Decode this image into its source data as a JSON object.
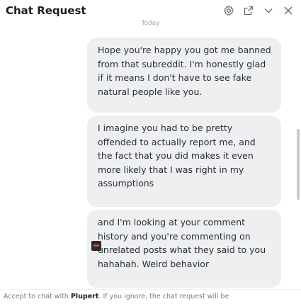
{
  "header": {
    "title": "Chat Request"
  },
  "day_divider": "Today",
  "messages": [
    {
      "text": "Hope you're happy you got me banned from that subreddit. I'm honestly glad if it means I don't have to see fake natural people like you."
    },
    {
      "text": "I imagine you had to be pretty offended to actually report me, and the fact that you did makes it even more likely that I was right in my assumptions"
    },
    {
      "text": "and I'm looking at your comment history and you're commenting on unrelated posts what they said to you hahahah. Weird behavior"
    }
  ],
  "footer": {
    "prefix": "Accept to chat with ",
    "username": "Plupert",
    "suffix": ". If you ignore, the chat request will be"
  },
  "icons": {
    "settings": "gear-icon",
    "popout": "popout-icon",
    "minimize": "chevron-down-icon",
    "close": "close-icon"
  }
}
